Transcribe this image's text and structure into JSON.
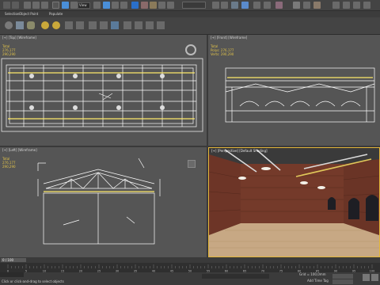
{
  "toolbar": {
    "selection_dropdown": "View",
    "icons": [
      "undo-icon",
      "redo-icon",
      "link-icon",
      "unlink-icon",
      "bind-icon",
      "select-filter-icon",
      "select-object-icon",
      "select-by-name-icon",
      "select-region-icon",
      "window-crossing-icon",
      "move-icon",
      "rotate-icon",
      "scale-icon",
      "reference-coord-icon",
      "pivot-icon",
      "snap-icon",
      "angle-snap-icon",
      "percent-snap-icon",
      "spinner-snap-icon",
      "named-selection-icon",
      "mirror-icon",
      "align-icon",
      "layer-icon",
      "graphite-icon",
      "curve-editor-icon",
      "schematic-icon",
      "material-editor-icon",
      "render-setup-icon",
      "rendered-frame-icon",
      "render-icon"
    ]
  },
  "ribbon": {
    "items": [
      "Selection",
      "Object Paint",
      "Populate"
    ]
  },
  "viewports": {
    "top_left": {
      "label": "[+] [Top] [Wireframe]",
      "stats": {
        "total_label": "Total",
        "polys": "276,177",
        "verts": "290,290"
      }
    },
    "top_right": {
      "label": "[+] [Front] [Wireframe]",
      "stats": {
        "total_label": "Total",
        "polys_label": "Polys:",
        "polys": "276,177",
        "verts_label": "Verts:",
        "verts": "290,290"
      }
    },
    "bottom_left": {
      "label": "[+] [Left] [Wireframe]",
      "stats": {
        "total_label": "Total",
        "polys": "276,177",
        "verts": "290,290"
      }
    },
    "bottom_right": {
      "label": "[+] [Perspective] [Default Shading]"
    }
  },
  "timeline": {
    "slider": "0 / 100",
    "ticks": [
      "0",
      "5",
      "10",
      "15",
      "20",
      "25",
      "30",
      "35",
      "40",
      "45",
      "50",
      "55",
      "60",
      "65",
      "70",
      "75",
      "80",
      "85",
      "90",
      "95",
      "100"
    ]
  },
  "status": {
    "message": "Click or click-and-drag to select objects",
    "grid": "Grid = 100,0mm",
    "add_time_tag": "Add Time Tag"
  },
  "colors": {
    "viewport_bg": "#555555",
    "wire": "#ffffff",
    "active_border": "#e3b63a",
    "stats_text": "#e0c24a"
  }
}
